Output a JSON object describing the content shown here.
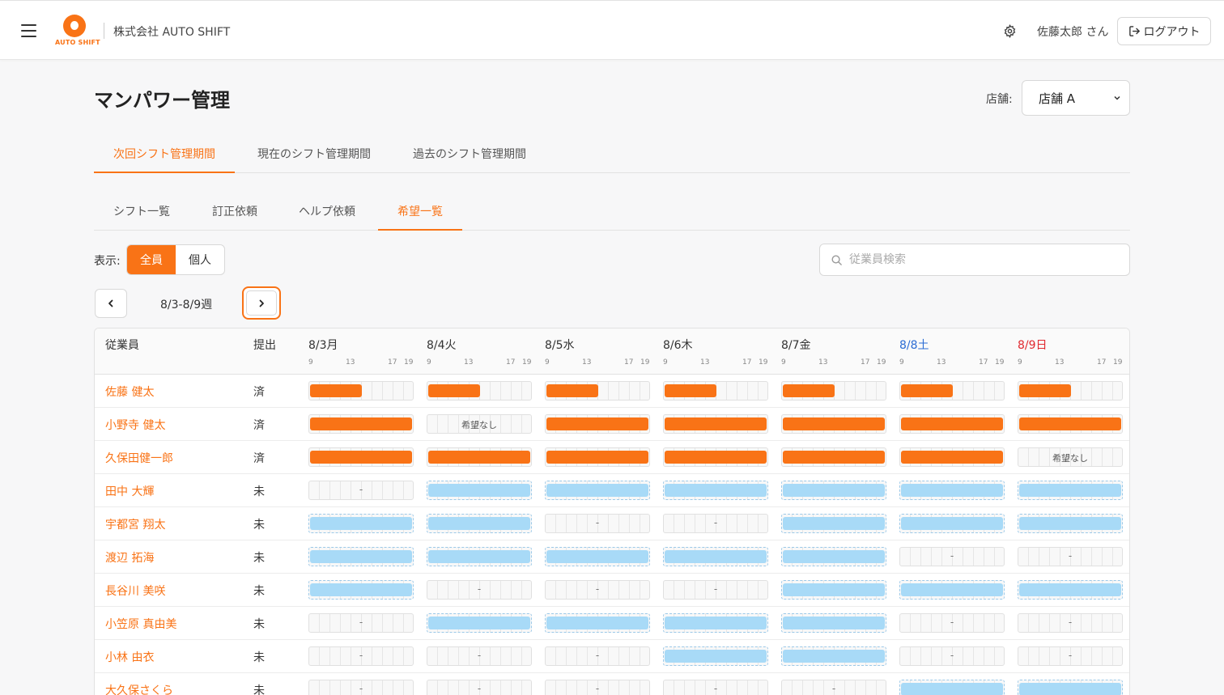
{
  "header": {
    "logo_text": "AUTO SHIFT",
    "company": "株式会社 AUTO SHIFT",
    "user": "佐藤太郎 さん",
    "logout": "ログアウト"
  },
  "page": {
    "title": "マンパワー管理",
    "store_label": "店舗:",
    "store_value": "店舗 A"
  },
  "tabs_primary": [
    "次回シフト管理期間",
    "現在のシフト管理期間",
    "過去のシフト管理期間"
  ],
  "tabs_secondary": [
    "シフト一覧",
    "訂正依頼",
    "ヘルプ依頼",
    "希望一覧"
  ],
  "filter": {
    "label": "表示:",
    "all": "全員",
    "individual": "個人",
    "search_placeholder": "従業員検索"
  },
  "week": {
    "label": "8/3-8/9週"
  },
  "table": {
    "col_employee": "従業員",
    "col_submitted": "提出",
    "ticks": [
      "9",
      "13",
      "17",
      "19"
    ],
    "days": [
      {
        "label": "8/3月",
        "kind": "weekday"
      },
      {
        "label": "8/4火",
        "kind": "weekday"
      },
      {
        "label": "8/5水",
        "kind": "weekday"
      },
      {
        "label": "8/6木",
        "kind": "weekday"
      },
      {
        "label": "8/7金",
        "kind": "weekday"
      },
      {
        "label": "8/8土",
        "kind": "sat"
      },
      {
        "label": "8/9日",
        "kind": "sun"
      }
    ],
    "colors": {
      "submitted": "#f97316",
      "unsubmitted": "#a8daf7",
      "accent": "#f97316"
    },
    "rows": [
      {
        "name": "佐藤 健太",
        "status": "済",
        "cells": [
          "half",
          "half",
          "half",
          "half",
          "half",
          "half",
          "half"
        ]
      },
      {
        "name": "小野寺 健太",
        "status": "済",
        "cells": [
          "full",
          "none",
          "full",
          "full",
          "full",
          "full",
          "full"
        ]
      },
      {
        "name": "久保田健一郎",
        "status": "済",
        "cells": [
          "full",
          "full",
          "full",
          "full",
          "full",
          "full",
          "none"
        ]
      },
      {
        "name": "田中 大輝",
        "status": "未",
        "cells": [
          "dash",
          "blue",
          "blue",
          "blue",
          "blue",
          "blue",
          "blue"
        ]
      },
      {
        "name": "宇都宮 翔太",
        "status": "未",
        "cells": [
          "blue",
          "blue",
          "dash",
          "dash",
          "blue",
          "blue",
          "blue"
        ]
      },
      {
        "name": "渡辺 拓海",
        "status": "未",
        "cells": [
          "blue",
          "blue",
          "blue",
          "blue",
          "blue",
          "dash",
          "dash"
        ]
      },
      {
        "name": "長谷川 美咲",
        "status": "未",
        "cells": [
          "blue",
          "dash",
          "dash",
          "dash",
          "blue",
          "blue",
          "blue"
        ]
      },
      {
        "name": "小笠原 真由美",
        "status": "未",
        "cells": [
          "dash",
          "blue",
          "blue",
          "blue",
          "blue",
          "dash",
          "dash"
        ]
      },
      {
        "name": "小林 由衣",
        "status": "未",
        "cells": [
          "dash",
          "dash",
          "dash",
          "blue",
          "blue",
          "dash",
          "dash"
        ]
      },
      {
        "name": "大久保さくら",
        "status": "未",
        "cells": [
          "dash",
          "dash",
          "dash",
          "dash",
          "dash",
          "blue",
          "blue"
        ]
      }
    ],
    "no_request_text": "希望なし",
    "dash_text": "-"
  }
}
